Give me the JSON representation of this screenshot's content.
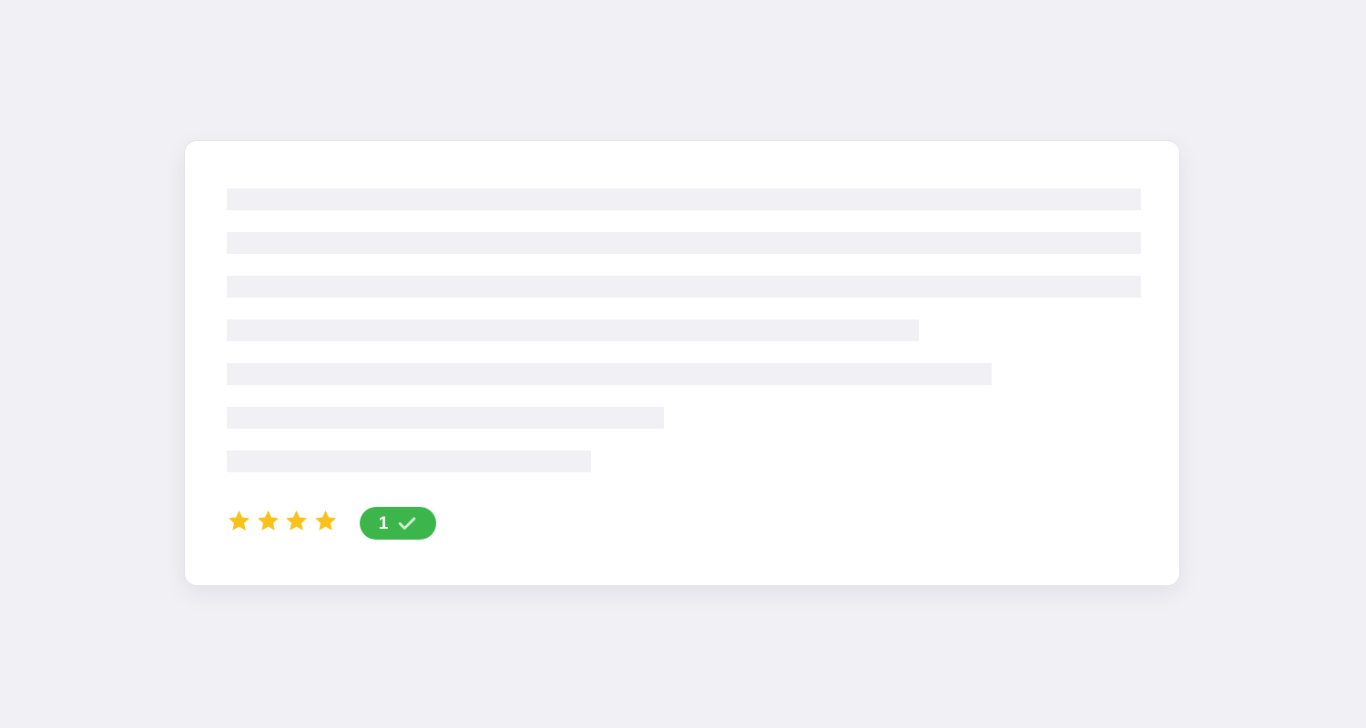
{
  "rating": {
    "value": 4,
    "max": 4,
    "star_color": "#f7c21b",
    "icon": "star-icon"
  },
  "badge": {
    "count": "1",
    "color": "#3cb64a",
    "icon": "check-icon"
  },
  "placeholder_lines": {
    "count": 7,
    "color": "#f1f1f5"
  }
}
